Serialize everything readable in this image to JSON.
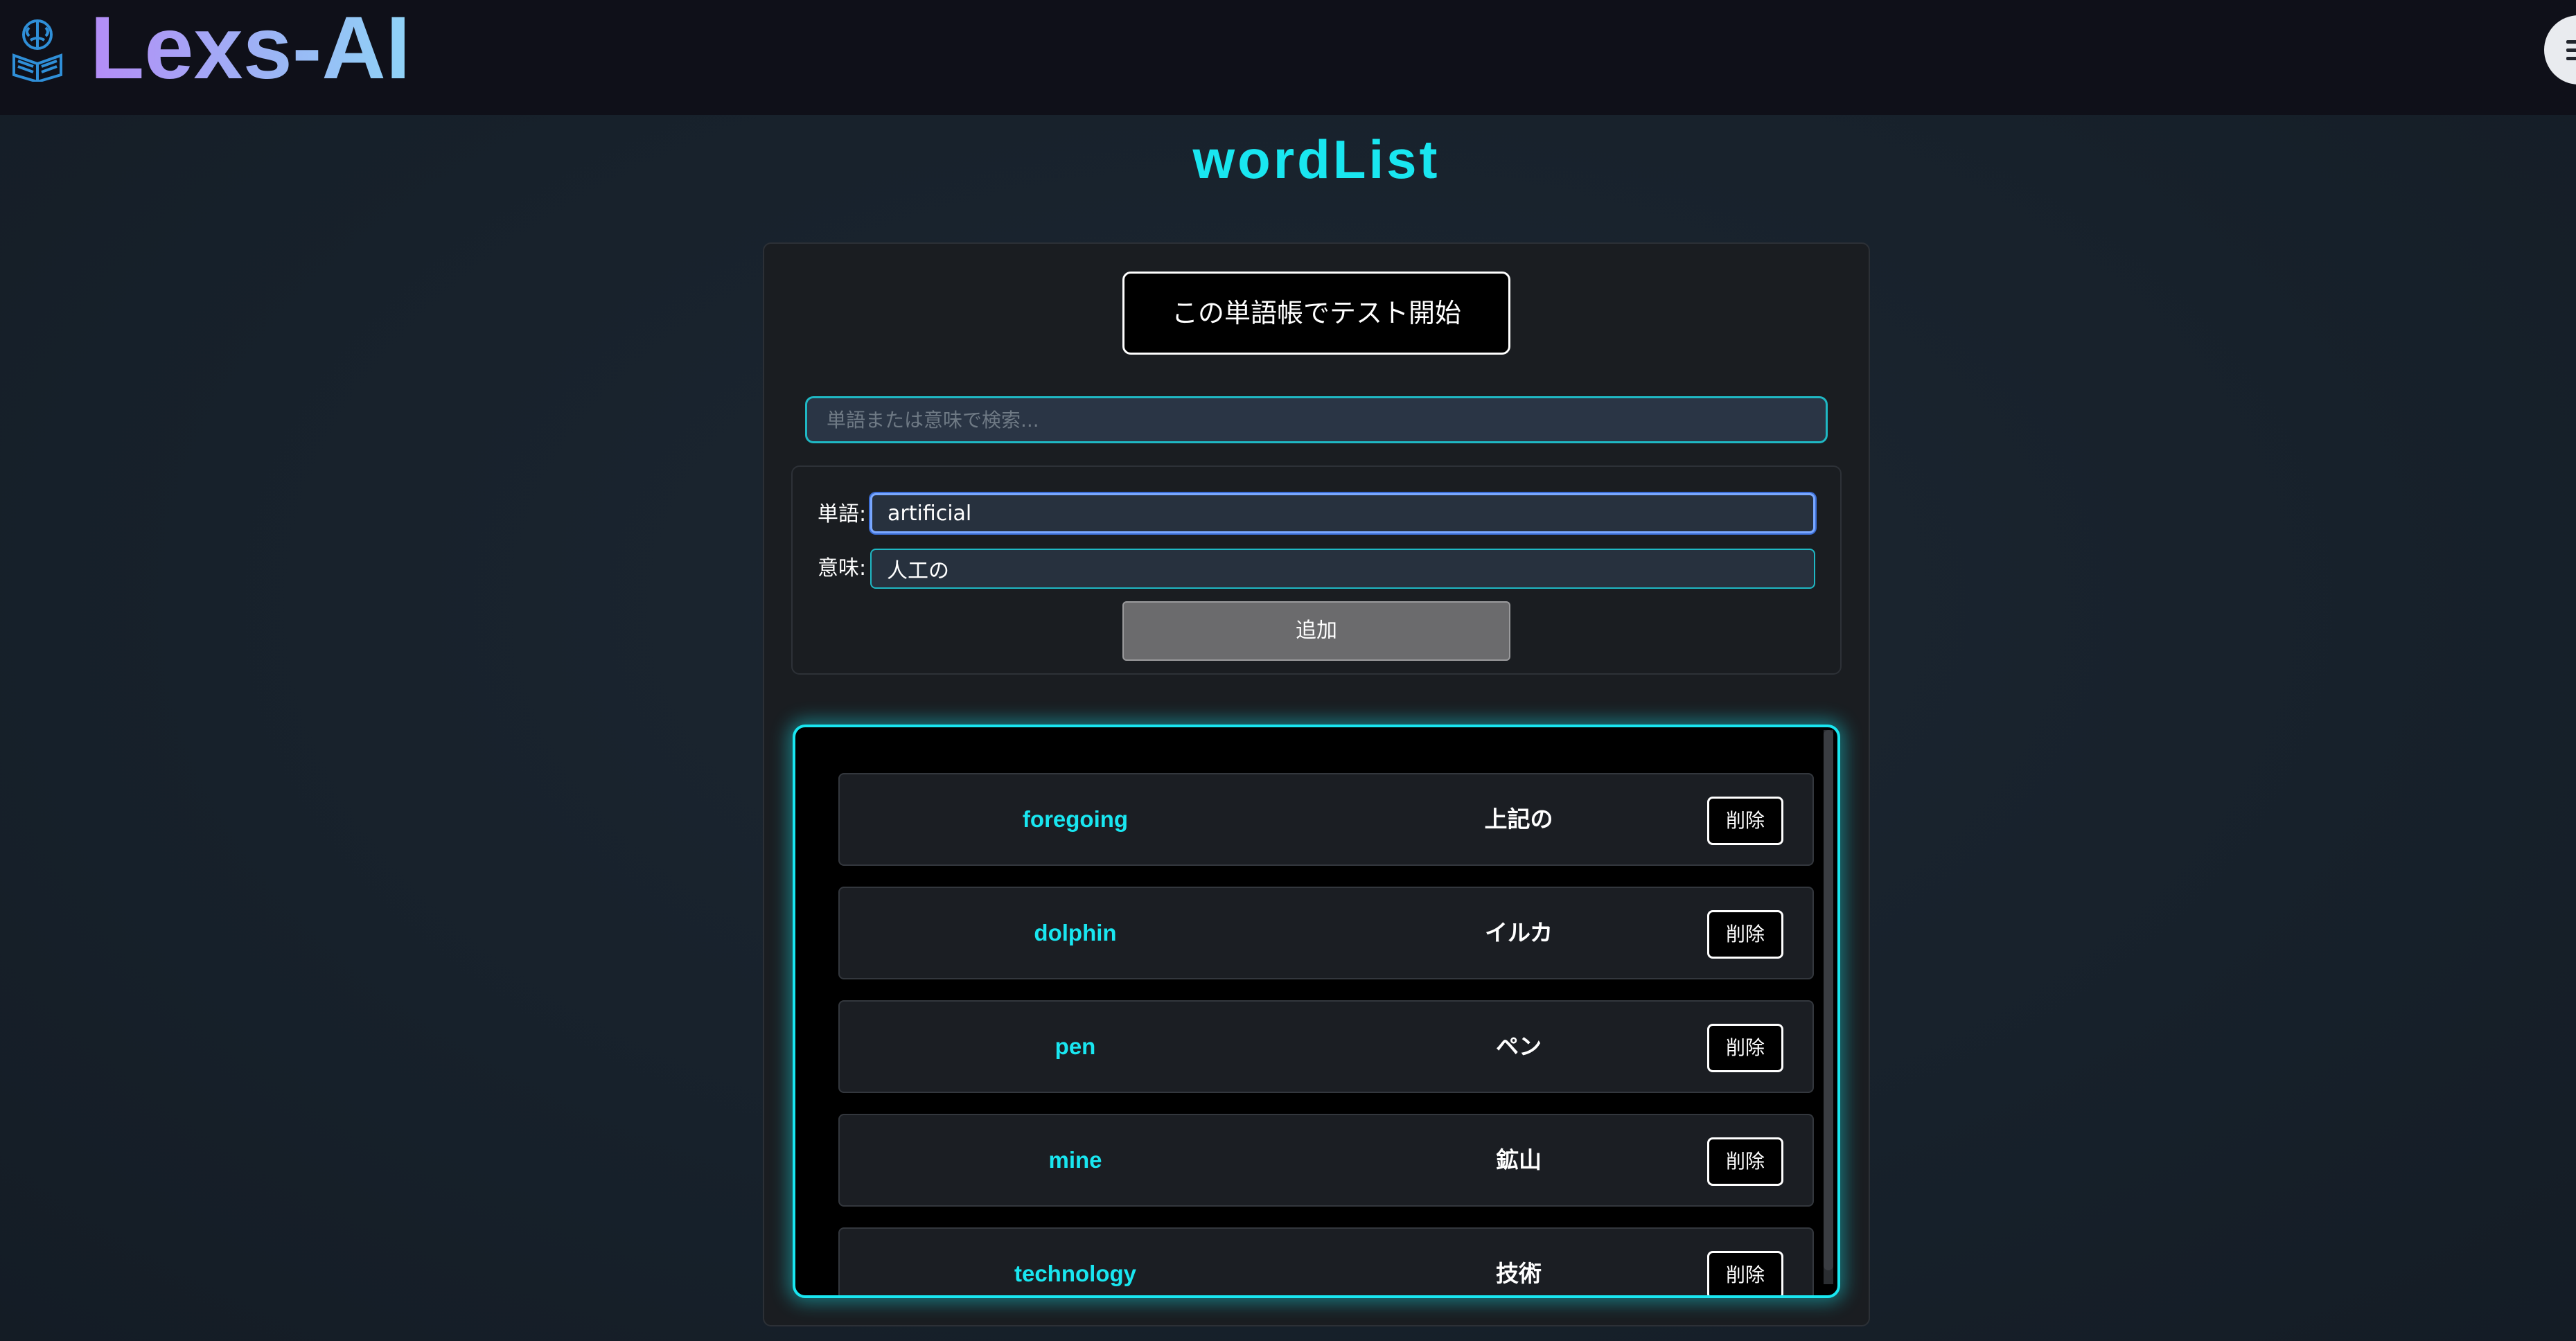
{
  "header": {
    "app_name": "Lexs-AI",
    "logo_icon": "brain-book-icon",
    "menu_icon": "hamburger-menu-icon"
  },
  "page": {
    "title": "wordList"
  },
  "actions": {
    "start_test_label": "この単語帳でテスト開始"
  },
  "search": {
    "placeholder": "単語または意味で検索...",
    "value": ""
  },
  "form": {
    "word_label": "単語:",
    "word_value": "artificial",
    "meaning_label": "意味:",
    "meaning_value": "人工の",
    "add_label": "追加"
  },
  "words": [
    {
      "word": "foregoing",
      "meaning": "上記の",
      "delete_label": "削除"
    },
    {
      "word": "dolphin",
      "meaning": "イルカ",
      "delete_label": "削除"
    },
    {
      "word": "pen",
      "meaning": "ペン",
      "delete_label": "削除"
    },
    {
      "word": "mine",
      "meaning": "鉱山",
      "delete_label": "削除"
    },
    {
      "word": "technology",
      "meaning": "技術",
      "delete_label": "削除"
    }
  ],
  "colors": {
    "accent": "#19e6f0",
    "background": "#17202a",
    "header": "#0f1019",
    "logo_gradient_start": "#b48cf7",
    "logo_gradient_end": "#8fd3f7"
  }
}
